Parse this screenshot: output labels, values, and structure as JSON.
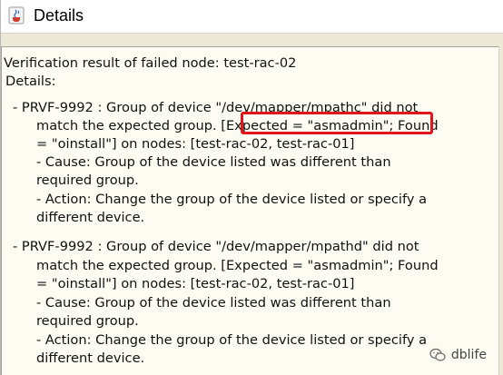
{
  "window": {
    "title": "Details",
    "icon": "java-cup-icon"
  },
  "details": {
    "heading": "Verification result of failed node: test-rac-02",
    "label": "Details:",
    "errors": [
      {
        "lines": [
          "-   PRVF-9992 : Group of device \"/dev/mapper/mpathc\" did not",
          "match the expected group. [Expected = \"asmadmin\"; Found",
          "= \"oinstall\"] on nodes: [test-rac-02, test-rac-01]",
          " - Cause:  Group of the device listed was different than",
          "required group.",
          " - Action:  Change the group of the device listed or specify a",
          "different device."
        ]
      },
      {
        "lines": [
          "-   PRVF-9992 : Group of device \"/dev/mapper/mpathd\" did not",
          "match the expected group. [Expected = \"asmadmin\"; Found",
          "= \"oinstall\"] on nodes: [test-rac-02, test-rac-01]",
          " - Cause:  Group of the device listed was different than",
          "required group.",
          " - Action:  Change the group of the device listed or specify a",
          "different device."
        ]
      }
    ]
  },
  "annotation": {
    "highlight_color": "#e0161b"
  },
  "watermark": {
    "text": "dblife",
    "icon": "wechat-icon"
  }
}
